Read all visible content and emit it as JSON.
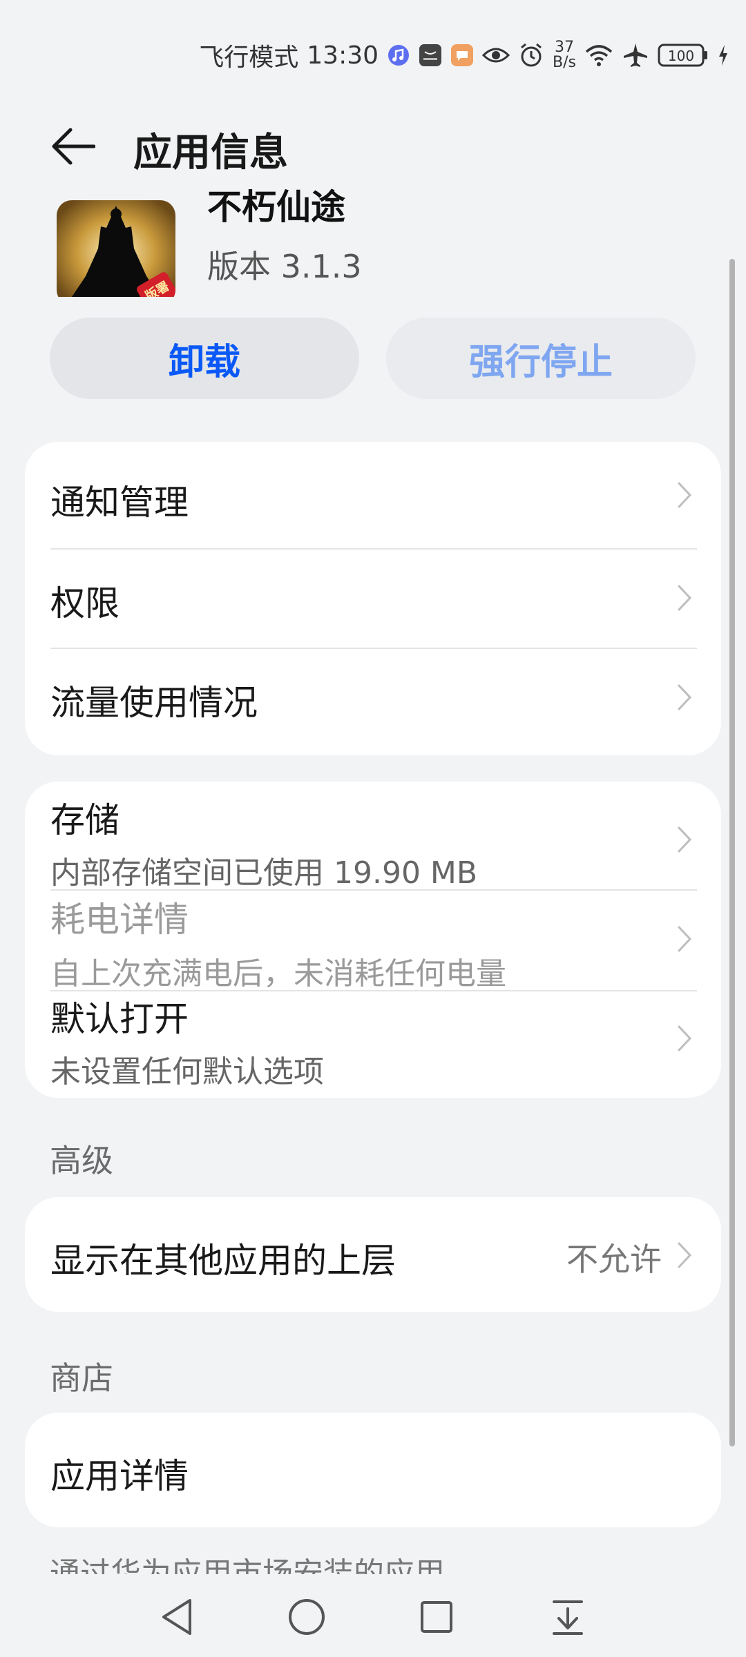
{
  "status_bar": {
    "airplane_mode_label": "飞行模式",
    "time": "13:30",
    "net_speed_top": "37",
    "net_speed_bottom": "B/s",
    "battery": "100",
    "icons": [
      "music-icon",
      "huawei-icon",
      "message-icon",
      "eye-icon",
      "alarm-icon",
      "wifi-icon",
      "airplane-icon",
      "battery-icon",
      "charging-icon"
    ]
  },
  "header": {
    "title": "应用信息"
  },
  "app": {
    "name": "不朽仙途",
    "version": "版本 3.1.3",
    "icon_badge": "版署"
  },
  "actions": {
    "uninstall": "卸载",
    "force_stop": "强行停止"
  },
  "card1": {
    "items": [
      {
        "title": "通知管理"
      },
      {
        "title": "权限"
      },
      {
        "title": "流量使用情况"
      }
    ]
  },
  "card2": {
    "items": [
      {
        "title": "存储",
        "subtitle": "内部存储空间已使用 19.90 MB"
      },
      {
        "title": "耗电详情",
        "subtitle": "自上次充满电后，未消耗任何电量"
      },
      {
        "title": "默认打开",
        "subtitle": "未设置任何默认选项"
      }
    ]
  },
  "advanced": {
    "label": "高级",
    "overlay_title": "显示在其他应用的上层",
    "overlay_value": "不允许"
  },
  "store": {
    "label": "商店",
    "details_title": "应用详情",
    "note": "通过华为应用市场安装的应用"
  },
  "colors": {
    "accent": "#0a59f7",
    "accent_disabled": "#7fa6f0",
    "background": "#f1f3f5",
    "card": "#ffffff"
  }
}
